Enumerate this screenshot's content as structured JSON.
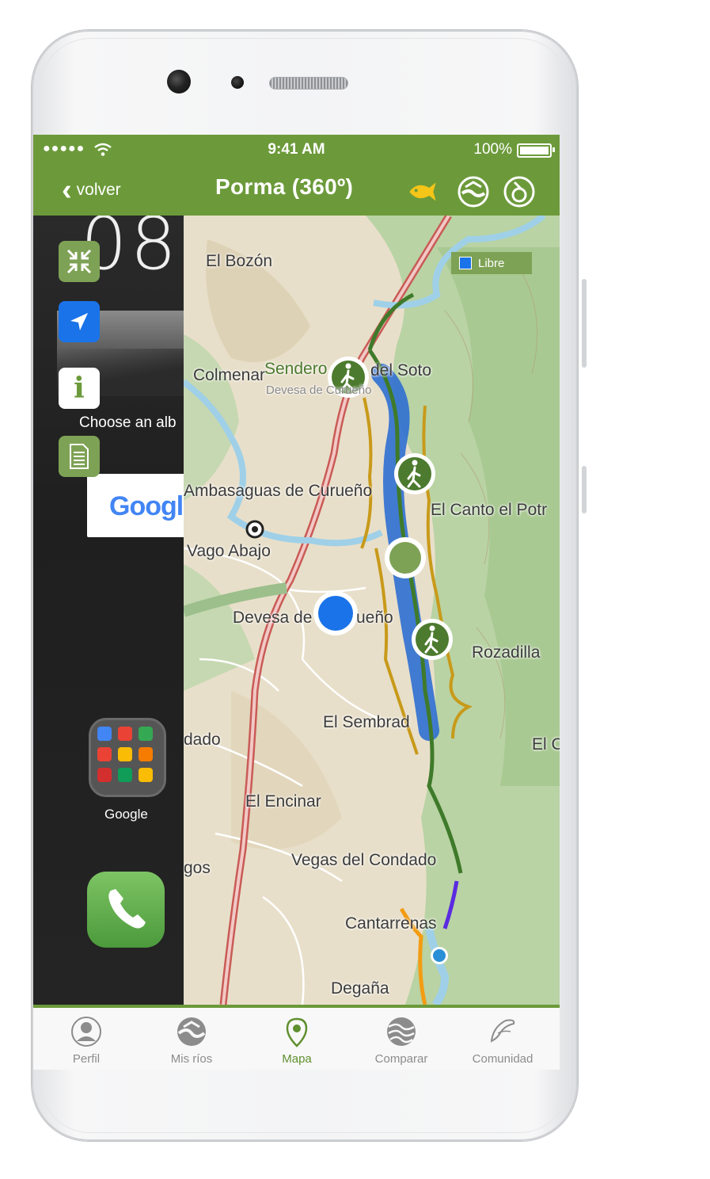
{
  "status_bar": {
    "signal": "●●●●●",
    "time": "9:41 AM",
    "battery": "100%"
  },
  "nav": {
    "back_label": "volver",
    "title": "Porma (360º)",
    "icons": [
      "fish-icon",
      "river-icon",
      "rain-gauge-icon"
    ]
  },
  "android_home": {
    "clock": "08:",
    "album_text": "Choose an alb",
    "google_partial": "Googl",
    "folder_label": "Google"
  },
  "map_tools": [
    "collapse-icon",
    "navigate-icon",
    "info-icon",
    "document-icon"
  ],
  "map": {
    "legend_label": "Libre",
    "legend_color": "#1a73e8",
    "places": [
      "El Bozón",
      "Colmenar",
      "Sendero",
      "del Soto",
      "Devesa de Curueño",
      "Ambasaguas de Curueño",
      "El Canto el Potr",
      "Vago Abajo",
      "Devesa de",
      "ueño",
      "Rozadilla",
      "El Sembrad",
      "dado",
      "El C",
      "El Encinar",
      "Vegas del Condado",
      "gos",
      "Cantarrenas",
      "Degaña"
    ]
  },
  "tabs": [
    {
      "label": "Perfil",
      "icon": "profile-icon"
    },
    {
      "label": "Mis ríos",
      "icon": "my-rivers-icon"
    },
    {
      "label": "Mapa",
      "icon": "map-pin-icon",
      "active": true
    },
    {
      "label": "Comparar",
      "icon": "compare-icon"
    },
    {
      "label": "Comunidad",
      "icon": "community-icon"
    }
  ],
  "colors": {
    "brand_green": "#6c9a3a",
    "stretch_blue": "#2f6fd1",
    "track_green": "#3f7a2a",
    "path_ochre": "#c89a1a"
  }
}
